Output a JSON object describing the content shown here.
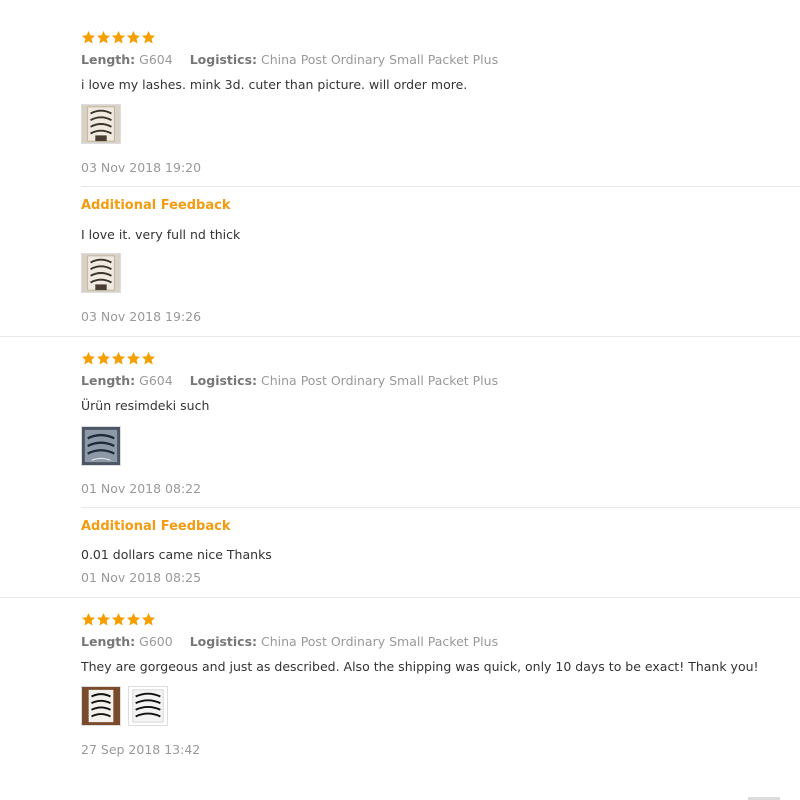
{
  "star_color": "#f5a000",
  "accent_color": "#f39c12",
  "labels": {
    "length": "Length:",
    "logistics": "Logistics:",
    "additional_feedback": "Additional Feedback"
  },
  "reviews": [
    {
      "rating": 5,
      "length": "G604",
      "logistics": "China Post Ordinary Small Packet Plus",
      "text": "i love my lashes. mink 3d. cuter than picture. will order more.",
      "date": "03 Nov 2018 19:20",
      "additional": {
        "text": "I love it. very full nd thick",
        "date": "03 Nov 2018 19:26"
      }
    },
    {
      "rating": 5,
      "length": "G604",
      "logistics": "China Post Ordinary Small Packet Plus",
      "text": "Ürün resimdeki such",
      "date": "01 Nov 2018 08:22",
      "additional": {
        "text": "0.01 dollars came nice Thanks",
        "date": "01 Nov 2018 08:25"
      }
    },
    {
      "rating": 5,
      "length": "G600",
      "logistics": "China Post Ordinary Small Packet Plus",
      "text": "They are gorgeous and just as described. Also the shipping was quick, only 10 days to be exact! Thank you!",
      "date": "27 Sep 2018 13:42"
    }
  ]
}
